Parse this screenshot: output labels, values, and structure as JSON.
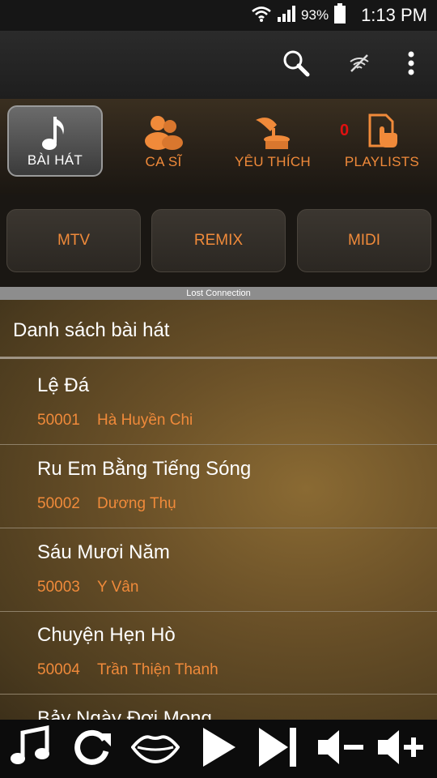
{
  "status_bar": {
    "battery_percent": "93%",
    "time": "1:13 PM",
    "battery_level": 0.93
  },
  "action_bar": {
    "icons": [
      "search-icon",
      "wifi-off-icon",
      "more-vert-icon"
    ]
  },
  "tabs": [
    {
      "label": "BÀI HÁT",
      "icon": "music-note-icon",
      "active": true
    },
    {
      "label": "CA SĨ",
      "icon": "singers-icon",
      "active": false
    },
    {
      "label": "YÊU THÍCH",
      "icon": "gramophone-icon",
      "active": false
    },
    {
      "label": "PLAYLISTS",
      "icon": "playlist-touch-icon",
      "active": false,
      "count": "0"
    }
  ],
  "categories": [
    {
      "label": "MTV"
    },
    {
      "label": "REMIX"
    },
    {
      "label": "MIDI"
    }
  ],
  "banner": "Lost Connection",
  "list": {
    "header": "Danh sách bài hát",
    "songs": [
      {
        "title": "Lệ Đá",
        "code": "50001",
        "artist": "Hà Huyền Chi"
      },
      {
        "title": "Ru Em Bằng Tiếng Sóng",
        "code": "50002",
        "artist": "Dương Thụ"
      },
      {
        "title": "Sáu Mươi Năm",
        "code": "50003",
        "artist": "Y Vân"
      },
      {
        "title": "Chuyện Hẹn Hò",
        "code": "50004",
        "artist": "Trần Thiện Thanh"
      },
      {
        "title": "Bảy Ngày Đợi Mong",
        "code": "",
        "artist": ""
      }
    ]
  },
  "controls": [
    "music-note-icon",
    "repeat-icon",
    "lips-icon",
    "play-icon",
    "skip-next-icon",
    "volume-down-icon",
    "volume-up-icon"
  ],
  "colors": {
    "accent": "#f08a3a",
    "count_red": "#e01010"
  }
}
